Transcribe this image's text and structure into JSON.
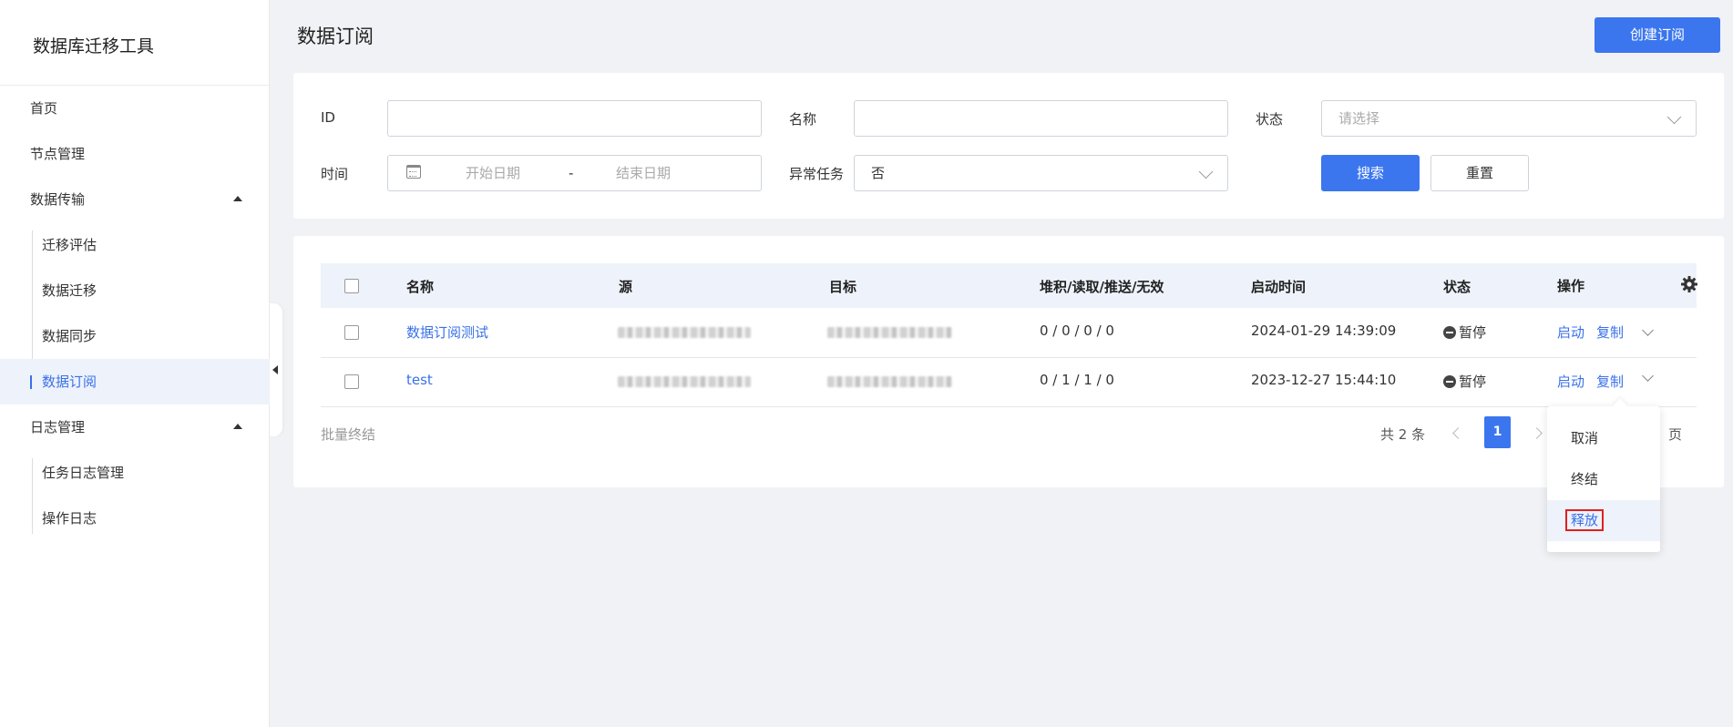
{
  "sidebar": {
    "brand": "数据库迁移工具",
    "items": [
      {
        "label": "首页"
      },
      {
        "label": "节点管理"
      },
      {
        "label": "数据传输"
      },
      {
        "label": "迁移评估"
      },
      {
        "label": "数据迁移"
      },
      {
        "label": "数据同步"
      },
      {
        "label": "数据订阅"
      },
      {
        "label": "日志管理"
      },
      {
        "label": "任务日志管理"
      },
      {
        "label": "操作日志"
      }
    ]
  },
  "header": {
    "title": "数据订阅",
    "create_button": "创建订阅"
  },
  "filters": {
    "id_label": "ID",
    "id_value": "",
    "name_label": "名称",
    "name_value": "",
    "status_label": "状态",
    "status_placeholder": "请选择",
    "time_label": "时间",
    "start_placeholder": "开始日期",
    "range_separator": "-",
    "end_placeholder": "结束日期",
    "abnormal_label": "异常任务",
    "abnormal_value": "否",
    "search_button": "搜索",
    "reset_button": "重置"
  },
  "table": {
    "columns": [
      "名称",
      "源",
      "目标",
      "堆积/读取/推送/无效",
      "启动时间",
      "状态",
      "操作"
    ],
    "rows": [
      {
        "name": "数据订阅测试",
        "counts": "0 / 0 / 0 / 0",
        "start_time": "2024-01-29 14:39:09",
        "status": "暂停",
        "action_start": "启动",
        "action_copy": "复制"
      },
      {
        "name": "test",
        "counts": "0 / 1 / 1 / 0",
        "start_time": "2023-12-27 15:44:10",
        "status": "暂停",
        "action_start": "启动",
        "action_copy": "复制"
      }
    ],
    "batch_action": "批量终结"
  },
  "pagination": {
    "total": "共 2 条",
    "current_page": "1",
    "page_unit": "页"
  },
  "dropdown": {
    "options": [
      "取消",
      "终结",
      "释放"
    ]
  }
}
